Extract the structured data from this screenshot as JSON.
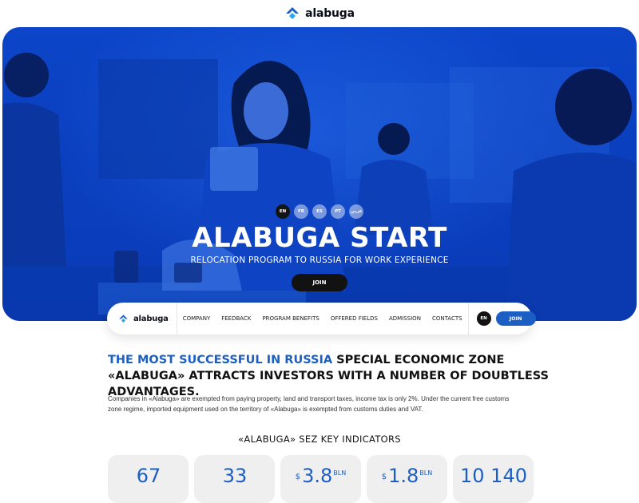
{
  "brand": {
    "name": "alabuga"
  },
  "hero": {
    "languages": [
      "EN",
      "FR",
      "ES",
      "PT",
      "عربي"
    ],
    "active_language": "EN",
    "title": "ALABUGA START",
    "subtitle": "RELOCATION PROGRAM TO RUSSIA FOR WORK EXPERIENCE",
    "join_label": "JOIN"
  },
  "nav": {
    "links": [
      "COMPANY",
      "FEEDBACK",
      "PROGRAM BENEFITS",
      "OFFERED FIELDS",
      "ADMISSION",
      "CONTACTS"
    ],
    "language": "EN",
    "join_label": "JOIN"
  },
  "intro": {
    "headline_highlight": "THE MOST SUCCESSFUL IN RUSSIA",
    "headline_rest": " SPECIAL ECONOMIC ZONE «ALABUGA» ATTRACTS INVESTORS WITH A NUMBER OF DOUBTLESS ADVANTAGES.",
    "description": "Companies in «Alabuga» are exempted from paying property, land and transport taxes, income tax is only 2%. Under the current free customs zone regime, imported equipment used on the territory of «Alabuga» is exempted from customs duties and VAT."
  },
  "indicators": {
    "title": "«ALABUGA» SEZ KEY INDICATORS",
    "cards": [
      {
        "currency": "",
        "value": "67",
        "unit": ""
      },
      {
        "currency": "",
        "value": "33",
        "unit": ""
      },
      {
        "currency": "$",
        "value": "3.8",
        "unit": "BLN"
      },
      {
        "currency": "$",
        "value": "1.8",
        "unit": "BLN"
      },
      {
        "currency": "",
        "value": "10 140",
        "unit": ""
      }
    ]
  },
  "colors": {
    "accent": "#1c5fc4",
    "hero_blue": "#0a3fbe",
    "dark": "#121212"
  }
}
